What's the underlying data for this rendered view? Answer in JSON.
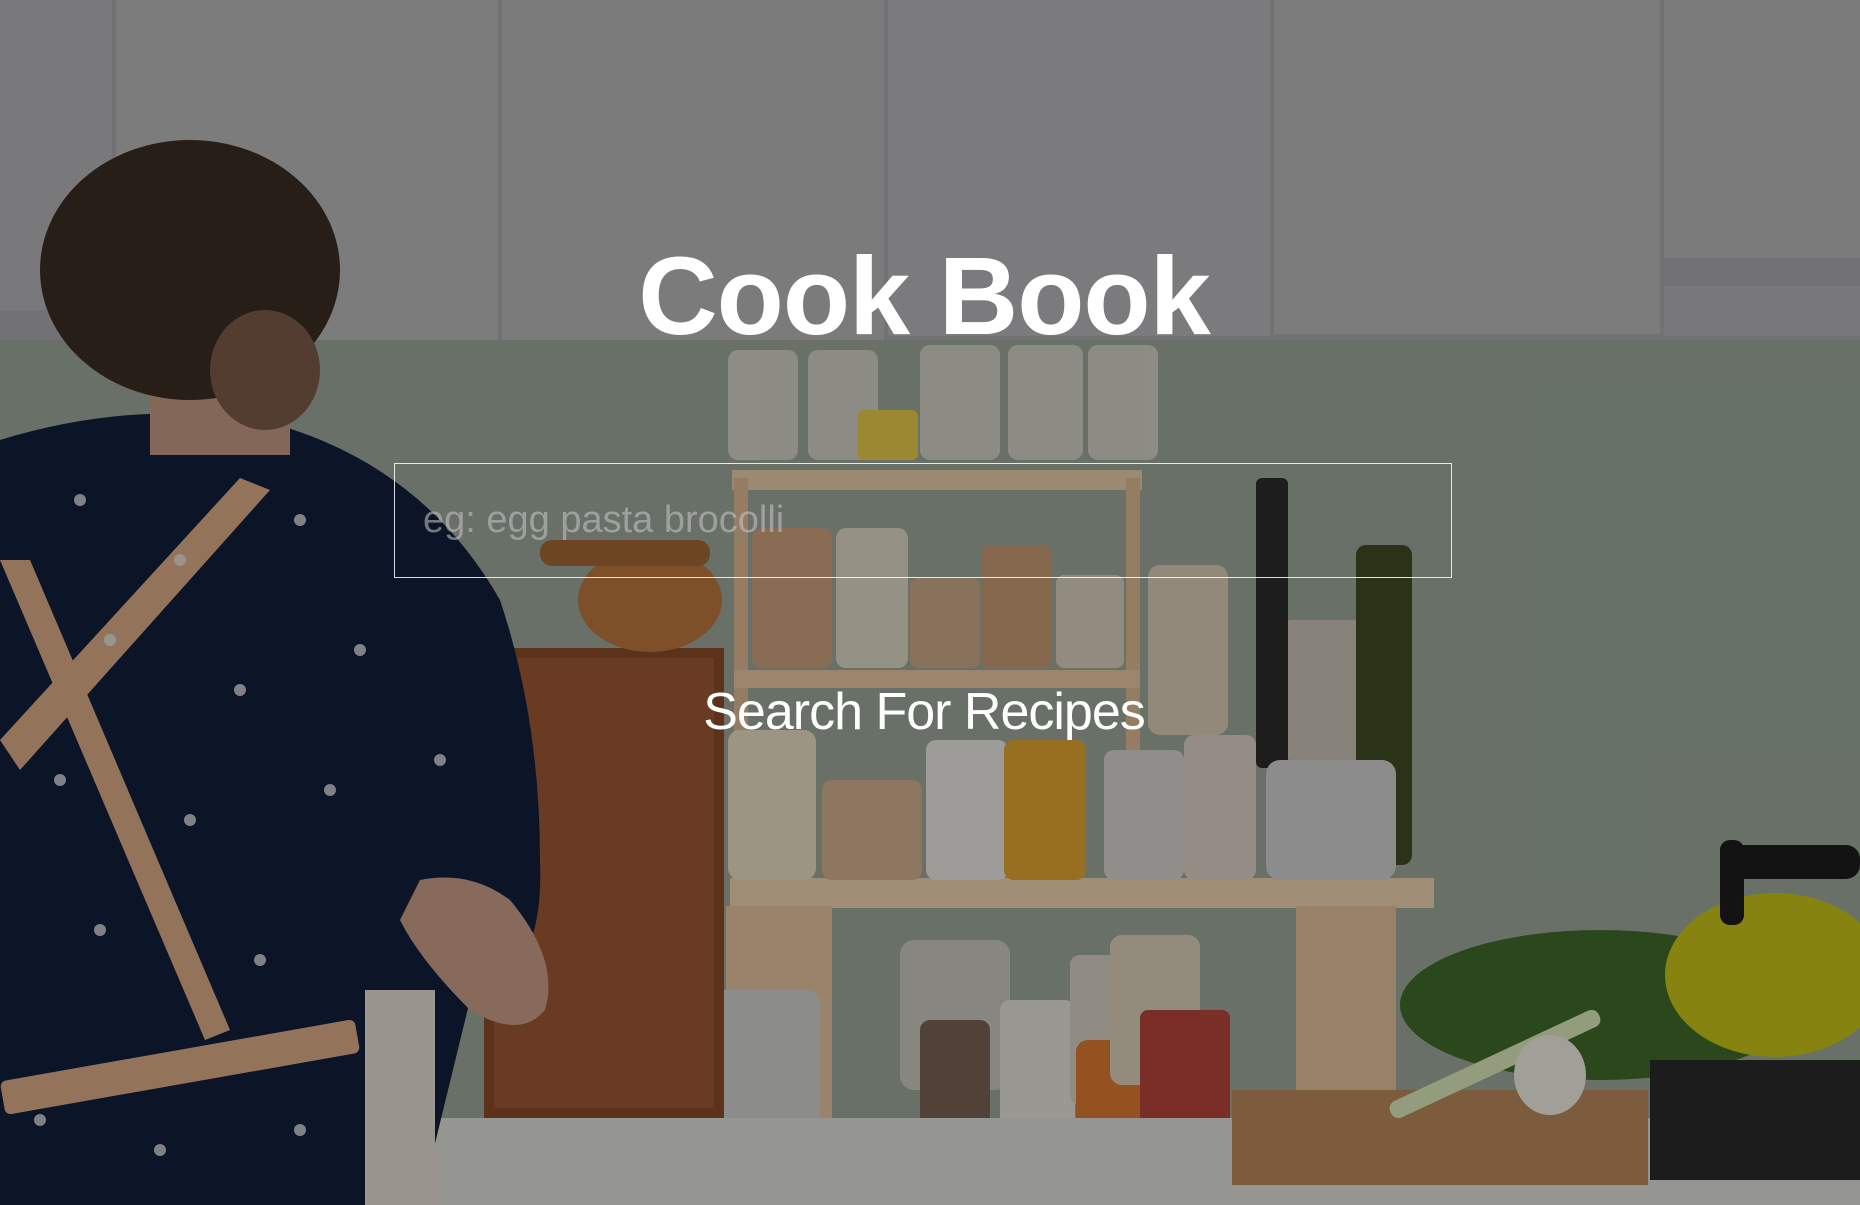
{
  "page": {
    "title": "Cook Book"
  },
  "search": {
    "placeholder": "eg: egg pasta brocolli",
    "value": "",
    "button_label": "Search For Recipes"
  },
  "colors": {
    "text": "#ffffff",
    "overlay": "#000000"
  }
}
